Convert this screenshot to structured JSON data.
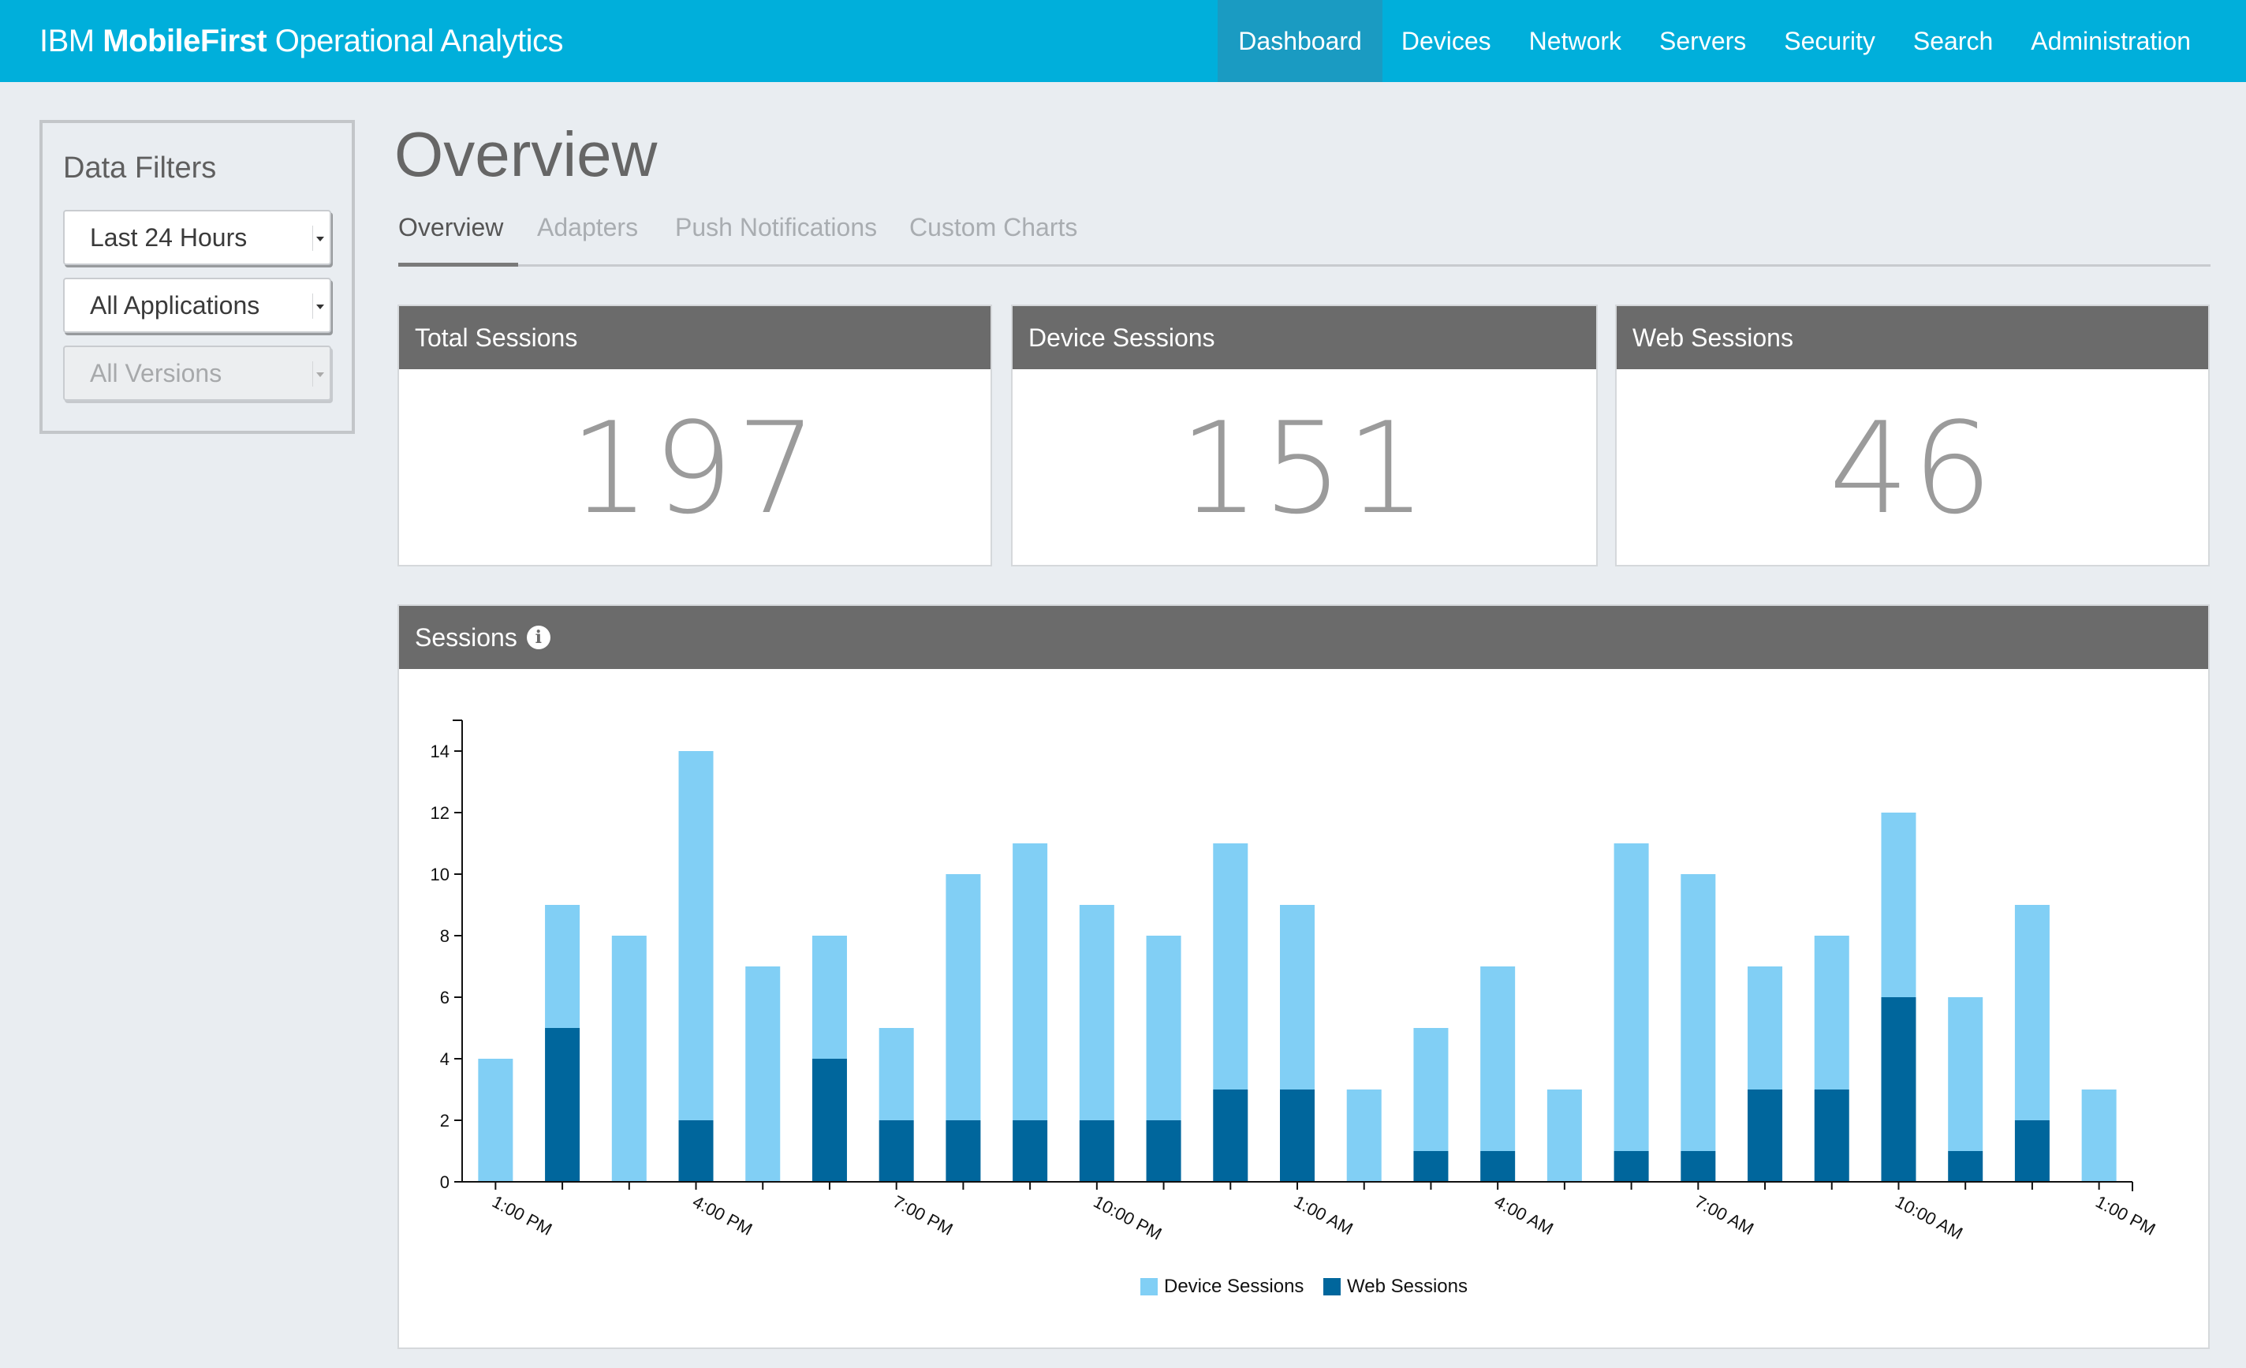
{
  "header": {
    "brand_prefix": "IBM",
    "brand_bold": "MobileFirst",
    "brand_suffix": "Operational Analytics",
    "nav": [
      {
        "label": "Dashboard",
        "active": true
      },
      {
        "label": "Devices"
      },
      {
        "label": "Network"
      },
      {
        "label": "Servers"
      },
      {
        "label": "Security"
      },
      {
        "label": "Search"
      },
      {
        "label": "Administration"
      }
    ]
  },
  "filters": {
    "title": "Data Filters",
    "time_range": "Last 24 Hours",
    "application": "All Applications",
    "version": "All Versions"
  },
  "main": {
    "title": "Overview",
    "tabs": [
      {
        "label": "Overview",
        "active": true
      },
      {
        "label": "Adapters"
      },
      {
        "label": "Push Notifications"
      },
      {
        "label": "Custom Charts"
      }
    ]
  },
  "stats": {
    "total": {
      "label": "Total Sessions",
      "value": "197"
    },
    "device": {
      "label": "Device Sessions",
      "value": "151"
    },
    "web": {
      "label": "Web Sessions",
      "value": "46"
    }
  },
  "sessions_panel": {
    "title": "Sessions",
    "info_icon": "info-icon"
  },
  "colors": {
    "topbar": "#00afdb",
    "device_series": "#81cff5",
    "web_series": "#00669c",
    "card_header": "#6b6b6b"
  },
  "chart_data": {
    "type": "bar",
    "stacked": true,
    "x_tick_labels": [
      "1:00 PM",
      "4:00 PM",
      "7:00 PM",
      "10:00 PM",
      "1:00 AM",
      "4:00 AM",
      "7:00 AM",
      "10:00 AM",
      "1:00 PM"
    ],
    "x_tick_label_every": 3,
    "bar_count": 25,
    "series": [
      {
        "name": "Web Sessions",
        "values": [
          0,
          5,
          0,
          2,
          0,
          4,
          2,
          2,
          2,
          2,
          2,
          3,
          3,
          0,
          1,
          1,
          0,
          1,
          1,
          3,
          3,
          6,
          1,
          2,
          0
        ]
      },
      {
        "name": "Device Sessions",
        "values": [
          4,
          4,
          8,
          12,
          7,
          4,
          3,
          8,
          9,
          7,
          6,
          8,
          6,
          3,
          4,
          6,
          3,
          10,
          9,
          4,
          5,
          6,
          5,
          7,
          3
        ]
      }
    ],
    "ylim": [
      0,
      15
    ],
    "yticks": [
      0,
      2,
      4,
      6,
      8,
      10,
      12,
      14
    ],
    "legend": [
      "Device Sessions",
      "Web Sessions"
    ],
    "legend_position": "bottom-center"
  }
}
